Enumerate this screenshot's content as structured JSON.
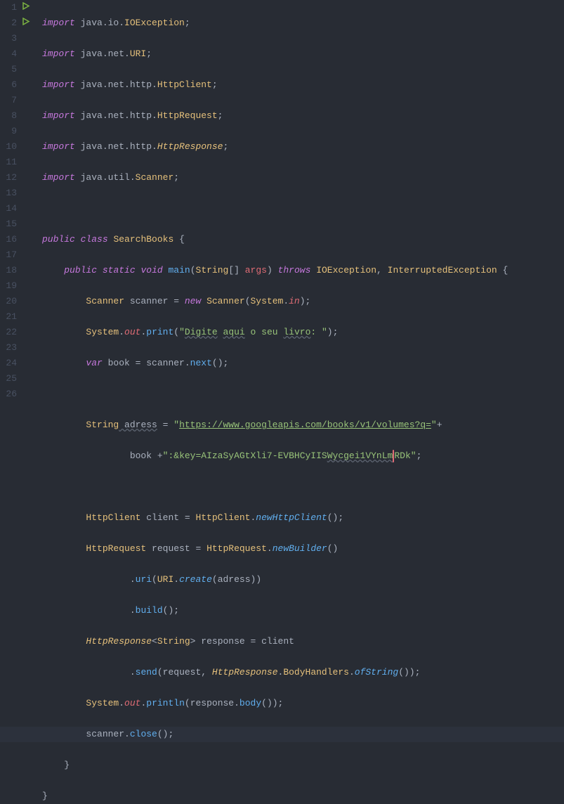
{
  "lines": [
    {
      "n": 1,
      "run": false
    },
    {
      "n": 2,
      "run": false
    },
    {
      "n": 3,
      "run": false
    },
    {
      "n": 4,
      "run": false
    },
    {
      "n": 5,
      "run": false
    },
    {
      "n": 6,
      "run": false
    },
    {
      "n": 7,
      "run": false
    },
    {
      "n": 8,
      "run": true
    },
    {
      "n": 9,
      "run": true
    },
    {
      "n": 10,
      "run": false
    },
    {
      "n": 11,
      "run": false
    },
    {
      "n": 12,
      "run": false
    },
    {
      "n": 13,
      "run": false
    },
    {
      "n": 14,
      "run": false
    },
    {
      "n": 15,
      "run": false
    },
    {
      "n": 16,
      "run": false
    },
    {
      "n": 17,
      "run": false
    },
    {
      "n": 18,
      "run": false
    },
    {
      "n": 19,
      "run": false
    },
    {
      "n": 20,
      "run": false
    },
    {
      "n": 21,
      "run": false
    },
    {
      "n": 22,
      "run": false
    },
    {
      "n": 23,
      "run": false
    },
    {
      "n": 24,
      "run": false
    },
    {
      "n": 25,
      "run": false
    },
    {
      "n": 26,
      "run": false
    }
  ],
  "code": {
    "l1": {
      "kw": "import",
      "pkg": " java.io.",
      "cls": "IOException",
      "end": ";"
    },
    "l2": {
      "kw": "import",
      "pkg": " java.net.",
      "cls": "URI",
      "end": ";"
    },
    "l3": {
      "kw": "import",
      "pkg": " java.net.http.",
      "cls": "HttpClient",
      "end": ";"
    },
    "l4": {
      "kw": "import",
      "pkg": " java.net.http.",
      "cls": "HttpRequest",
      "end": ";"
    },
    "l5": {
      "kw": "import",
      "pkg": " java.net.http.",
      "cls": "HttpResponse",
      "end": ";"
    },
    "l6": {
      "kw": "import",
      "pkg": " java.util.",
      "cls": "Scanner",
      "end": ";"
    },
    "l8": {
      "mod1": "public",
      "mod2": "class",
      "name": "SearchBooks",
      "brace": " {"
    },
    "l9": {
      "mod1": "public",
      "mod2": "static",
      "ret": "void",
      "fn": "main",
      "lp": "(",
      "ptype": "String",
      "arr": "[] ",
      "pname": "args",
      "rp": ")",
      "thr": " throws ",
      "ex1": "IOException",
      "comma": ",",
      "ex2": " InterruptedException",
      "brace": " {"
    },
    "l10": {
      "type": "Scanner",
      "var": " scanner",
      "eq": " = ",
      "new": "new ",
      "ctor": "Scanner",
      "lp": "(",
      "sys": "System",
      "dot": ".",
      "in": "in",
      "rp": ")",
      "end": ";"
    },
    "l11": {
      "sys": "System",
      "d1": ".",
      "out": "out",
      "d2": ".",
      "fn": "print",
      "lp": "(",
      "s1": "\"",
      "s2": "Digite",
      "sp1": " ",
      "s3": "aqui",
      "sp2": " o seu ",
      "s4": "livro",
      "s5": ": \"",
      "rp": ")",
      "end": ";"
    },
    "l12": {
      "var_kw": "var",
      "name": " book",
      "eq": " = ",
      "obj": "scanner",
      "dot": ".",
      "fn": "next",
      "paren": "()",
      "end": ";"
    },
    "l14": {
      "type": "String",
      "name": " adress",
      "eq": " = ",
      "q1": "\"",
      "url": "https://www.googleapis.com/books/v1/volumes?q=",
      "q2": "\"",
      "plus": "+"
    },
    "l15": {
      "obj": "book ",
      "plus": "+",
      "q1": "\"",
      "s1": ":&key=AIzaSyAGtXli7-EVBHCyIIS",
      "s2": "Wycgei1VYnLm",
      "s3": "RDk\"",
      "end": ";"
    },
    "l17": {
      "type": "HttpClient",
      "var": " client",
      "eq": " = ",
      "cls": "HttpClient",
      "dot": ".",
      "fn": "newHttpClient",
      "paren": "()",
      "end": ";"
    },
    "l18": {
      "type": "HttpRequest",
      "var": " request",
      "eq": " = ",
      "cls": "HttpRequest",
      "dot": ".",
      "fn": "newBuilder",
      "paren": "()"
    },
    "l19": {
      "dot": ".",
      "fn": "uri",
      "lp": "(",
      "cls": "URI",
      "d2": ".",
      "fn2": "create",
      "lp2": "(",
      "arg": "adress",
      "rp": "))"
    },
    "l20": {
      "dot": ".",
      "fn": "build",
      "paren": "()",
      "end": ";"
    },
    "l21": {
      "type": "HttpResponse",
      "lt": "<",
      "gtype": "String",
      "gt": ">",
      "var": " response",
      "eq": " = ",
      "obj": "client"
    },
    "l22": {
      "dot": ".",
      "fn": "send",
      "lp": "(",
      "a1": "request",
      "comma": ", ",
      "cls": "HttpResponse",
      "d2": ".",
      "sub": "BodyHandlers",
      "d3": ".",
      "fn2": "ofString",
      "paren": "())",
      "end": ";"
    },
    "l23": {
      "sys": "System",
      "d1": ".",
      "out": "out",
      "d2": ".",
      "fn": "println",
      "lp": "(",
      "obj": "response",
      "d3": ".",
      "fn2": "body",
      "paren": "())",
      "end": ";"
    },
    "l24": {
      "obj": "scanner",
      "dot": ".",
      "fn": "close",
      "paren": "()",
      "end": ";"
    },
    "l25": {
      "brace": "}"
    },
    "l26": {
      "brace": "}"
    }
  },
  "highlighted_line": 24,
  "indent": {
    "i1": "    ",
    "i2": "        ",
    "i3": "                "
  }
}
